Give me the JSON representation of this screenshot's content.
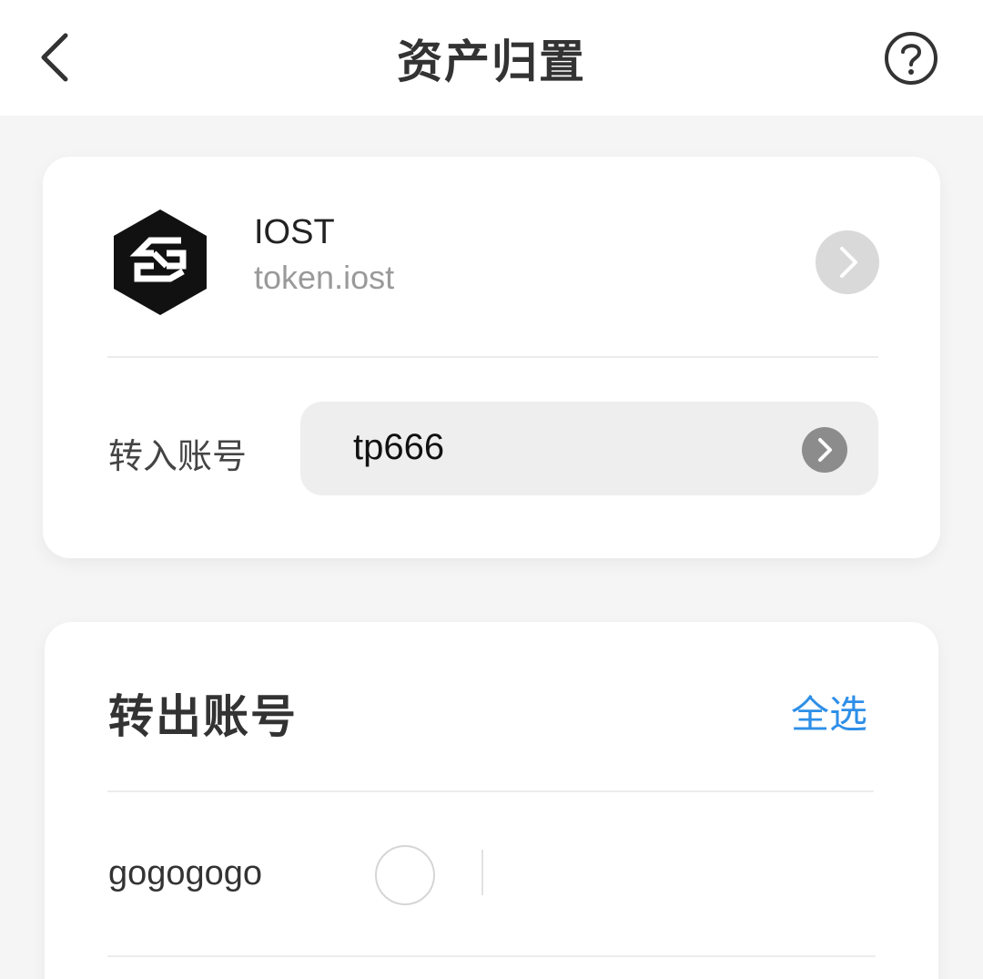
{
  "header": {
    "title": "资产归置",
    "back_icon": "chevron-left-icon",
    "help_icon": "question-circle-icon"
  },
  "token": {
    "symbol": "IOST",
    "contract": "token.iost",
    "logo_icon": "iost-logo-icon",
    "arrow_icon": "chevron-right-icon"
  },
  "transfer_in": {
    "label": "转入账号",
    "account": "tp666",
    "arrow_icon": "chevron-right-circle-icon"
  },
  "transfer_out": {
    "title": "转出账号",
    "select_all_label": "全选",
    "accounts": [
      {
        "name": "gogogogo",
        "selected": false,
        "amount": ""
      }
    ]
  },
  "colors": {
    "accent": "#2e8fe8",
    "background": "#f5f5f5",
    "card": "#ffffff"
  }
}
